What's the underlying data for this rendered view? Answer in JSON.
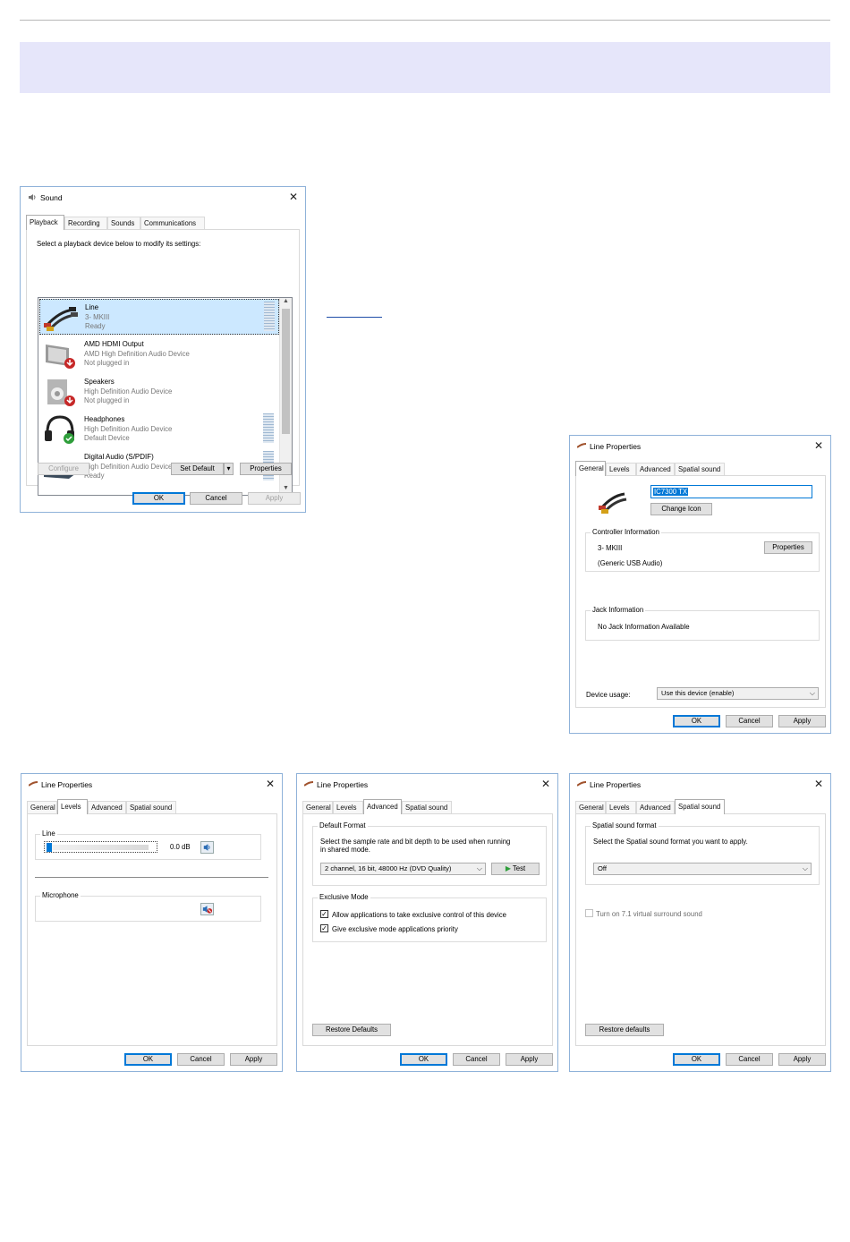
{
  "sound": {
    "title": "Sound",
    "tabs": [
      "Playback",
      "Recording",
      "Sounds",
      "Communications"
    ],
    "instruction": "Select a playback device below to modify its settings:",
    "devices": [
      {
        "name": "Line",
        "line2": "3- MKIII",
        "line3": "Ready"
      },
      {
        "name": "AMD HDMI Output",
        "line2": "AMD High Definition Audio Device",
        "line3": "Not plugged in"
      },
      {
        "name": "Speakers",
        "line2": "High Definition Audio Device",
        "line3": "Not plugged in"
      },
      {
        "name": "Headphones",
        "line2": "High Definition Audio Device",
        "line3": "Default Device"
      },
      {
        "name": "Digital Audio (S/PDIF)",
        "line2": "High Definition Audio Device",
        "line3": "Ready"
      }
    ],
    "configure": "Configure",
    "set_default": "Set Default",
    "properties": "Properties",
    "ok": "OK",
    "cancel": "Cancel",
    "apply": "Apply"
  },
  "line_props": {
    "title": "Line Properties",
    "tabs": [
      "General",
      "Levels",
      "Advanced",
      "Spatial sound"
    ],
    "ok": "OK",
    "cancel": "Cancel",
    "apply": "Apply",
    "general": {
      "name_value": "IC7300 TX",
      "change_icon": "Change Icon",
      "controller_label": "Controller Information",
      "controller_name": "3- MKIII",
      "controller_type": "(Generic USB Audio)",
      "properties": "Properties",
      "jack_label": "Jack Information",
      "jack_text": "No Jack Information Available",
      "usage_label": "Device usage:",
      "usage_value": "Use this device (enable)"
    },
    "levels": {
      "line_label": "Line",
      "line_value": "0.0 dB",
      "line_level_fraction": 0,
      "mic_label": "Microphone"
    },
    "advanced": {
      "format_label": "Default Format",
      "format_desc_1": "Select the sample rate and bit depth to be used when running",
      "format_desc_2": "in shared mode.",
      "format_value": "2 channel, 16 bit, 48000 Hz (DVD Quality)",
      "test": "Test",
      "exclusive_label": "Exclusive Mode",
      "exclusive_1": "Allow applications to take exclusive control of this device",
      "exclusive_2": "Give exclusive mode applications priority",
      "restore": "Restore Defaults"
    },
    "spatial": {
      "format_label": "Spatial sound format",
      "desc": "Select the Spatial sound format you want to apply.",
      "value": "Off",
      "virtual": "Turn on 7.1 virtual surround sound",
      "restore": "Restore defaults"
    }
  }
}
